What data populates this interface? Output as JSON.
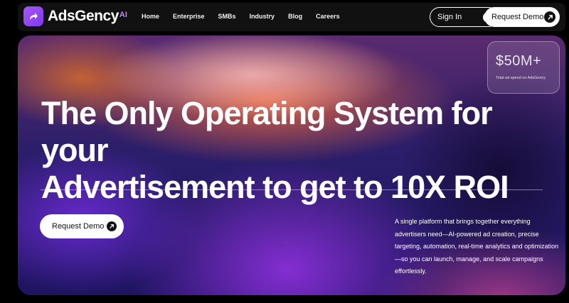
{
  "brand": {
    "name": "AdsGency",
    "suffix": "AI",
    "logo_icon": "share-arrow-icon",
    "accent": "#a855f7"
  },
  "nav": {
    "links": [
      "Home",
      "Enterprise",
      "SMBs",
      "Industry",
      "Blog",
      "Careers"
    ],
    "signin_label": "Sign In",
    "request_demo_label": "Request Demo"
  },
  "hero": {
    "stat_value": "$50M+",
    "stat_label": "Total ad spend on AdsGency",
    "headline_line1": "The Only Operating System for your",
    "headline_line2": "Advertisement to get to 10X ROI",
    "cta_label": "Request Demo",
    "description": "A single platform that brings together everything advertisers need—AI-powered ad creation, precise targeting, automation, real-time analytics and optimization—so you can launch, manage, and scale campaigns effortlessly."
  },
  "colors": {
    "background": "#000000",
    "nav_bg": "#111111",
    "hero_orange": "#f26b3a",
    "hero_purple": "#6e2bd9"
  }
}
